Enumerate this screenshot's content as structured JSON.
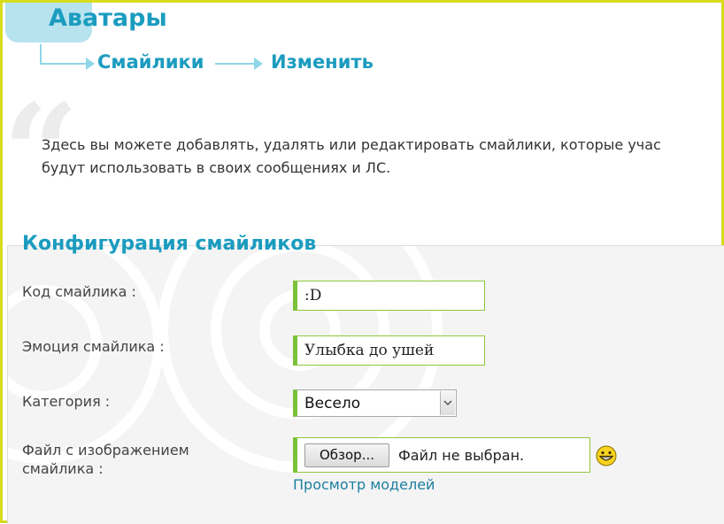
{
  "header": {
    "title": "Аватары",
    "breadcrumb": [
      {
        "label": "Смайлики"
      },
      {
        "label": "Изменить"
      }
    ]
  },
  "intro": {
    "line1": "Здесь вы можете добавлять, удалять или редактировать смайлики, которые учас",
    "line2": "будут использовать в своих сообщениях и ЛС."
  },
  "form": {
    "section_title": "Конфигурация смайликов",
    "code_label": "Код смайлика :",
    "code_value": ":D",
    "emotion_label": "Эмоция смайлика :",
    "emotion_value": "Улыбка до ушей",
    "category_label": "Категория :",
    "category_value": "Весело",
    "file_label_line1": "Файл с изображением",
    "file_label_line2": "смайлика :",
    "browse_label": "Обзор...",
    "file_status": "Файл не выбран.",
    "preview_link": "Просмотр моделей"
  },
  "colors": {
    "accent": "#1b9cbf",
    "field_border": "#7bc23a",
    "frame": "#d8dc1c"
  }
}
